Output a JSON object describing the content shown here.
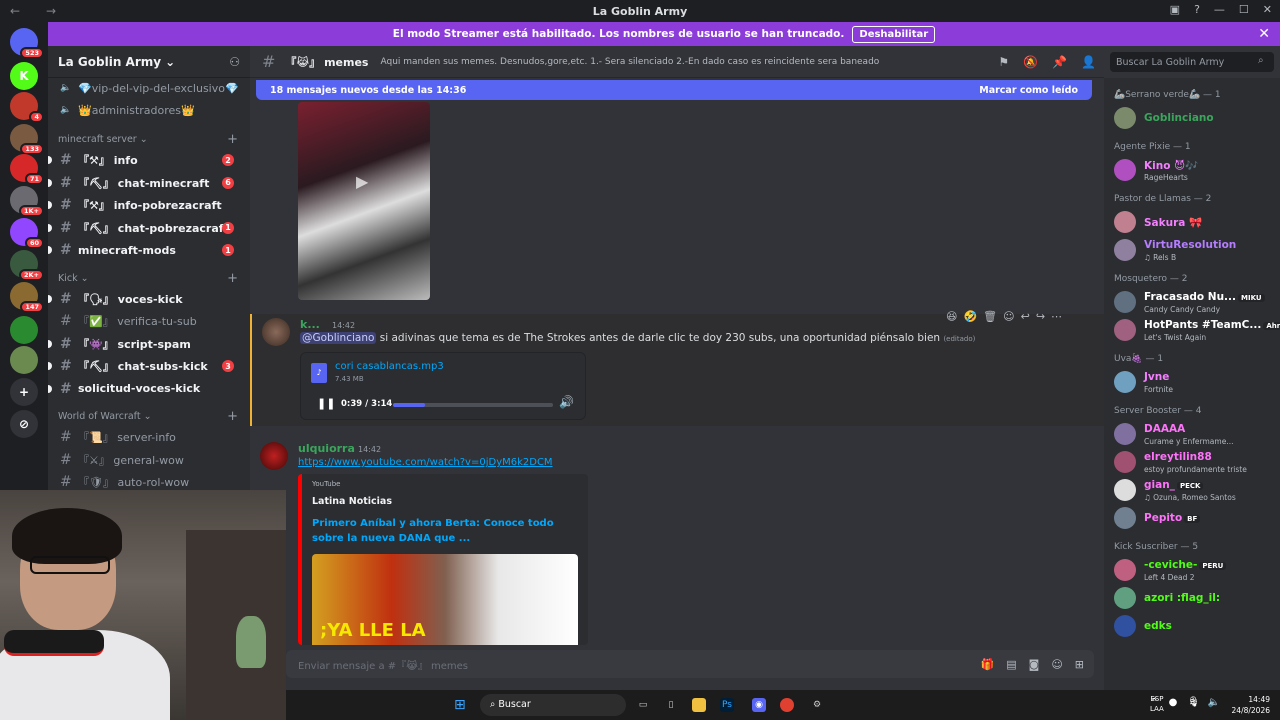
{
  "window": {
    "title": "La Goblin Army",
    "back": "←",
    "forward": "→"
  },
  "banner": {
    "text": "El modo Streamer está habilitado. Los nombres de usuario se han truncado.",
    "button": "Deshabilitar"
  },
  "guilds": [
    {
      "label": "",
      "badge": "523",
      "color": "#5865f2"
    },
    {
      "label": "K",
      "badge": "",
      "color": "#53fc18"
    },
    {
      "label": "",
      "badge": "4",
      "color": "#c0392b"
    },
    {
      "label": "",
      "badge": "133",
      "color": "#7a5a40"
    },
    {
      "label": "",
      "badge": "71",
      "color": "#d62828"
    },
    {
      "label": "",
      "badge": "1K+",
      "color": "#6a6a70"
    },
    {
      "label": "",
      "badge": "60",
      "color": "#9146ff"
    },
    {
      "label": "",
      "badge": "2K+",
      "color": "#3a5a40"
    },
    {
      "label": "",
      "badge": "147",
      "color": "#8a6a30"
    },
    {
      "label": "",
      "badge": "",
      "color": "#2a8a30"
    },
    {
      "label": "",
      "badge": "",
      "color": "#6a8a50"
    },
    {
      "label": "+",
      "badge": "",
      "color": "#313338"
    },
    {
      "label": "⊘",
      "badge": "",
      "color": "#313338"
    }
  ],
  "server": {
    "name": "La Goblin Army",
    "chevron": "⌄"
  },
  "sidebar": {
    "top_channels": [
      "💎vip-del-vip-del-exclusivo💎",
      "👑administradores👑"
    ],
    "categories": [
      {
        "name": "minecraft server",
        "channels": [
          {
            "name": "『⚒』 info",
            "badge": "2",
            "unread": true
          },
          {
            "name": "『⛏』 chat-minecraft",
            "badge": "6",
            "unread": true
          },
          {
            "name": "『⚒』 info-pobrezacraft",
            "badge": "",
            "unread": true
          },
          {
            "name": "『⛏』 chat-pobrezacraft",
            "badge": "1",
            "unread": true
          },
          {
            "name": "minecraft-mods",
            "badge": "1",
            "unread": true
          }
        ]
      },
      {
        "name": "Kick",
        "channels": [
          {
            "name": "『🗣』 voces-kick",
            "badge": "",
            "unread": true
          },
          {
            "name": "『✅』 verifica-tu-sub",
            "badge": "",
            "unread": false
          },
          {
            "name": "『👾』 script-spam",
            "badge": "",
            "unread": true
          },
          {
            "name": "『⛏』 chat-subs-kick",
            "badge": "3",
            "unread": true
          },
          {
            "name": "solicitud-voces-kick",
            "badge": "",
            "unread": true
          }
        ]
      },
      {
        "name": "World of Warcraft",
        "channels": [
          {
            "name": "『📜』 server-info",
            "badge": "",
            "unread": false
          },
          {
            "name": "『⚔』 general-wow",
            "badge": "",
            "unread": false
          },
          {
            "name": "『🛡』 auto-rol-wow",
            "badge": "",
            "unread": false
          }
        ]
      }
    ]
  },
  "channel": {
    "name": "『😹』 memes",
    "topic": "Aqui manden sus memes. Desnudos,gore,etc. 1.- Sera silenciado 2.-En dado caso es reincidente sera baneado"
  },
  "search": {
    "placeholder": "Buscar La Goblin Army"
  },
  "newbar": {
    "text": "18 mensajes nuevos desde las 14:36",
    "mark": "Marcar como leído"
  },
  "messages": [
    {
      "author": "k...",
      "time": "14:42",
      "mention": "@Goblinciano",
      "text": " si adivinas que tema es de The Strokes antes de darle clic te doy 230 subs, una oportunidad piénsalo bien",
      "edited": "(editado)",
      "attachment": {
        "name": "cori casablancas.mp3",
        "size": "7.43 MB",
        "time": "0:39 / 3:14",
        "progress": 0.2
      }
    },
    {
      "author": "ulquiorra",
      "time": "14:42",
      "link": "https://www.youtube.com/watch?v=0jDyM6k2DCM",
      "embed": {
        "provider": "YouTube",
        "author": "Latina Noticias",
        "title": "Primero Aníbal y ahora Berta: Conoce todo sobre la nueva DANA que ...",
        "overlay": ";YA LLE LA"
      }
    }
  ],
  "composer": {
    "placeholder": "Enviar mensaje a #『😹』 memes"
  },
  "members": {
    "groups": [
      {
        "name": "🦾Serrano verde🦾 — 1",
        "members": [
          {
            "name": "Goblinciano",
            "status": "",
            "color": "#3ba55c",
            "tag": ""
          }
        ]
      },
      {
        "name": "Agente Pixie — 1",
        "members": [
          {
            "name": "Kino 😈🎶",
            "status": "RageHearts",
            "color": "#f47fff",
            "tag": ""
          }
        ]
      },
      {
        "name": "Pastor de Llamas — 2",
        "members": [
          {
            "name": "Sakura 🎀",
            "status": "",
            "color": "#f47fff",
            "tag": ""
          },
          {
            "name": "VirtuResolution",
            "status": "♫ Rels B",
            "color": "#b57dff",
            "tag": ""
          }
        ]
      },
      {
        "name": "Mosquetero — 2",
        "members": [
          {
            "name": "Fracasado Nu...",
            "status": "Candy Candy Candy",
            "color": "#ffffff",
            "tag": "MIKU"
          },
          {
            "name": "HotPants #TeamC...",
            "status": "Let's Twist Again",
            "color": "#ffffff",
            "tag": "Ahri"
          }
        ]
      },
      {
        "name": "Uva🍇 — 1",
        "members": [
          {
            "name": "Jvne",
            "status": "Fortnite",
            "color": "#f47fff",
            "tag": ""
          }
        ]
      },
      {
        "name": "Server Booster — 4",
        "members": [
          {
            "name": "DAAAA",
            "status": "Curame y Enfermame...",
            "color": "#ff73fa",
            "tag": ""
          },
          {
            "name": "elreytilin88",
            "status": "estoy profundamente triste",
            "color": "#ff73fa",
            "tag": ""
          },
          {
            "name": "gian_",
            "status": "♫ Ozuna, Romeo Santos",
            "color": "#ff73fa",
            "tag": "PECK"
          },
          {
            "name": "Pepito",
            "status": "",
            "color": "#ff73fa",
            "tag": "BF"
          }
        ]
      },
      {
        "name": "Kick Suscriber — 5",
        "members": [
          {
            "name": "-ceviche-",
            "status": "Left 4 Dead 2",
            "color": "#53fc18",
            "tag": "PERU"
          },
          {
            "name": "azori :flag_il:",
            "status": "",
            "color": "#53fc18",
            "tag": ""
          },
          {
            "name": "edks",
            "status": "",
            "color": "#53fc18",
            "tag": ""
          }
        ]
      }
    ]
  },
  "taskbar": {
    "search": "Buscar",
    "lang": [
      "ESP",
      "LAA"
    ],
    "time": "14:49",
    "date": "24/8/2026"
  },
  "colors": {
    "accent": "#5865f2",
    "banner": "#8c3cd9",
    "link": "#00a8fc",
    "danger": "#f23f43"
  }
}
